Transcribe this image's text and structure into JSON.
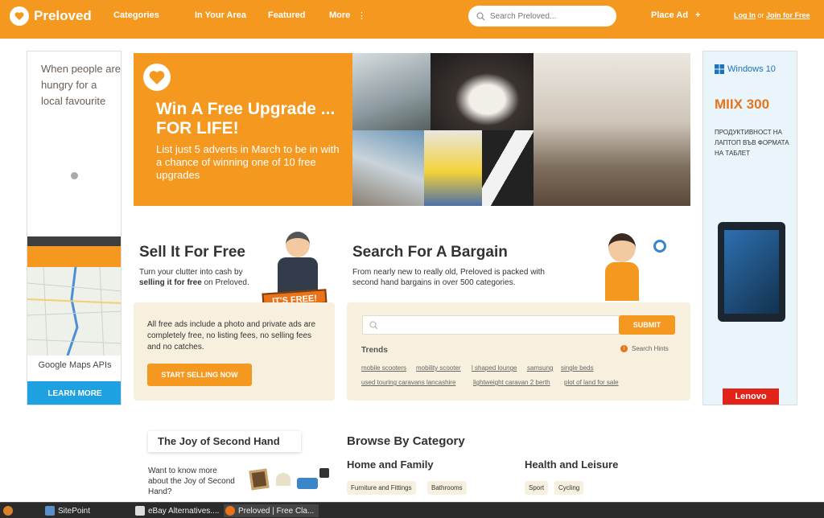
{
  "header": {
    "logo": "Preloved",
    "nav": [
      "Categories",
      "In Your Area",
      "Featured",
      "More"
    ],
    "search_placeholder": "Search Preloved...",
    "place_ad": "Place Ad",
    "login": "Log In",
    "or": "or",
    "join": "Join for Free"
  },
  "left_ad": {
    "tagline": "When people are hungry for a local favourite",
    "provider": "Google Maps APIs",
    "cta": "LEARN MORE"
  },
  "right_ad": {
    "os": "Windows 10",
    "model": "MIIX 300",
    "description": "ПРОДУКТИВНОСТ НА ЛАПТОП ВЪВ ФОРМАТА НА ТАБЛЕТ",
    "brand": "Lenovo"
  },
  "hero": {
    "heading": "Win A Free Upgrade ... FOR LIFE!",
    "text": "List just 5 adverts in March to be in with a chance of winning one of 10 free upgrades"
  },
  "sell": {
    "title": "Sell It For Free",
    "subtitle_1": "Turn your clutter into cash by",
    "subtitle_bold": "selling it for free",
    "subtitle_2": "on Preloved.",
    "badge": "IT'S FREE!",
    "body": "All free ads include a photo and private ads are completely free, no listing fees, no selling fees and no catches.",
    "cta": "START SELLING NOW"
  },
  "search": {
    "title": "Search For A Bargain",
    "subtitle": "From nearly new to really old, Preloved is packed with second hand bargains in over 500 categories.",
    "submit": "SUBMIT",
    "trends_label": "Trends",
    "hints": "Search Hints",
    "trends": [
      "mobile scooters",
      "mobility scooter",
      "l shaped lounge",
      "samsung",
      "single beds",
      "used touring caravans lancashire",
      "lightweight caravan 2 berth",
      "plot of land for sale"
    ]
  },
  "joy": {
    "title": "The Joy of Second Hand",
    "text": "Want to know more about the Joy of Second Hand?"
  },
  "browse": {
    "title": "Browse By Category",
    "home": "Home and Family",
    "home_items": [
      "Furniture and Fittings",
      "Bathrooms"
    ],
    "health": "Health and Leisure",
    "health_items": [
      "Sport",
      "Cycling"
    ]
  },
  "taskbar": {
    "items": [
      "SitePoint",
      "eBay Alternatives....",
      "Preloved | Free Cla..."
    ]
  }
}
